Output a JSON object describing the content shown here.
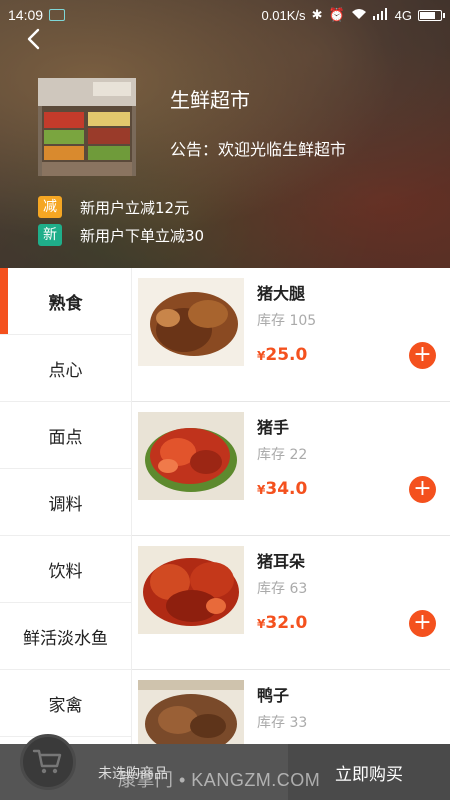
{
  "status_bar": {
    "time": "14:09",
    "network_speed": "0.01K/s",
    "network_type": "4G",
    "icons": [
      "app-notification-icon",
      "bluetooth-icon",
      "alarm-icon",
      "wifi-icon",
      "signal-icon",
      "battery-icon"
    ]
  },
  "header": {
    "store_name": "生鲜超市",
    "notice": "公告：欢迎光临生鲜超市",
    "promotions": [
      {
        "tag": "减",
        "tag_color": "#f5a623",
        "text": "新用户立减12元"
      },
      {
        "tag": "新",
        "tag_color": "#1fae8a",
        "text": "新用户下单立减30"
      }
    ]
  },
  "categories": [
    {
      "label": "熟食",
      "active": true
    },
    {
      "label": "点心",
      "active": false
    },
    {
      "label": "面点",
      "active": false
    },
    {
      "label": "调料",
      "active": false
    },
    {
      "label": "饮料",
      "active": false
    },
    {
      "label": "鲜活淡水鱼",
      "active": false
    },
    {
      "label": "家禽",
      "active": false
    }
  ],
  "products": [
    {
      "name": "猪大腿",
      "stock": "库存 105",
      "currency": "¥",
      "price": "25.0"
    },
    {
      "name": "猪手",
      "stock": "库存 22",
      "currency": "¥",
      "price": "34.0"
    },
    {
      "name": "猪耳朵",
      "stock": "库存 63",
      "currency": "¥",
      "price": "32.0"
    },
    {
      "name": "鸭子",
      "stock": "库存 33",
      "currency": "¥",
      "price": ""
    }
  ],
  "bottom_bar": {
    "cart_status": "未选购商品",
    "buy_label": "立即购买",
    "watermark": "康掌门 • KANGZM.COM"
  },
  "colors": {
    "accent": "#f4511e",
    "bottom_bar": "#555555"
  }
}
